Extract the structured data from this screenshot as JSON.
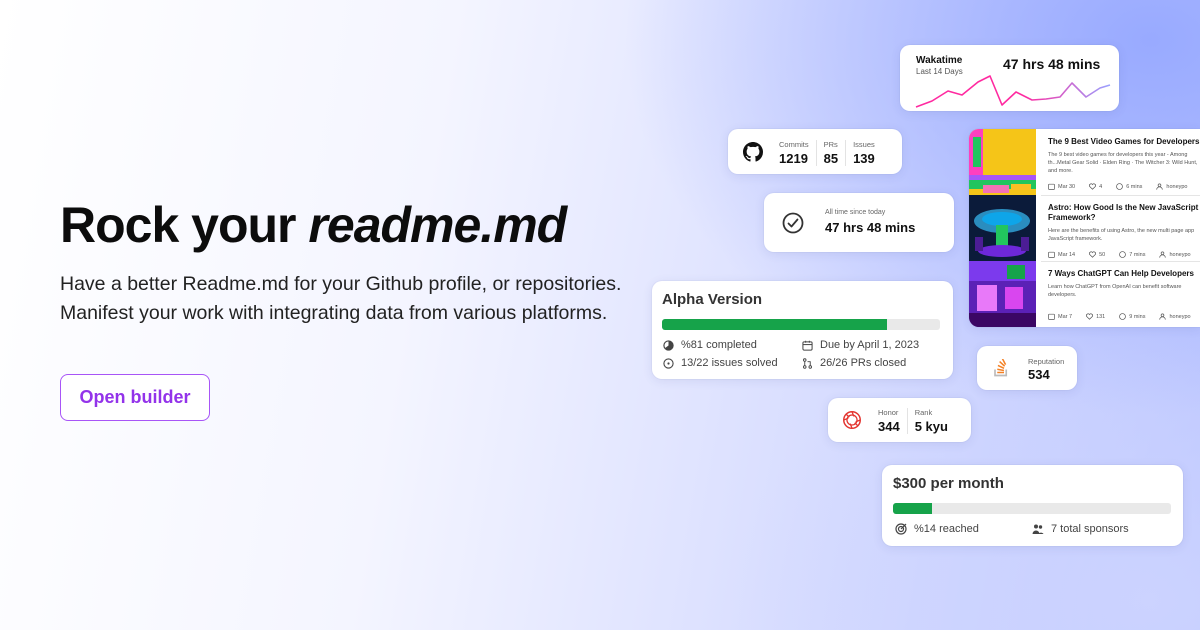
{
  "hero": {
    "title_main": "Rock your",
    "title_em": "readme.md",
    "desc_line1": "Have a better Readme.md for your Github profile, or repositories.",
    "desc_line2": "Manifest your work with integrating data from various platforms.",
    "button_label": "Open builder"
  },
  "wakatime": {
    "name": "Wakatime",
    "period": "Last 14 Days",
    "total": "47 hrs 48 mins"
  },
  "github": {
    "icon": "github-icon",
    "stats": [
      {
        "label": "Commits",
        "value": "1219"
      },
      {
        "label": "PRs",
        "value": "85"
      },
      {
        "label": "Issues",
        "value": "139"
      }
    ]
  },
  "alltime": {
    "icon": "check-clock-icon",
    "label": "All time since today",
    "value": "47 hrs 48 mins"
  },
  "milestone": {
    "title": "Alpha Version",
    "progress": 0.81,
    "completed": "%81 completed",
    "due": "Due by April 1, 2023",
    "issues": "13/22 issues solved",
    "prs": "26/26 PRs closed"
  },
  "articles": [
    {
      "title": "The 9 Best Video Games for Developers",
      "desc": "The 9 best video games for developers this year - Among th...Metal Gear Solid · Elden Ring · The Witcher 3: Wild Hunt, and more.",
      "date": "Mar 30",
      "likes": "4",
      "read": "6 mins",
      "author": "honeypo"
    },
    {
      "title": "Astro: How Good Is the New JavaScript Framework?",
      "desc": "Here are the benefits of using Astro, the new multi page app JavaScript framework.",
      "date": "Mar 14",
      "likes": "50",
      "read": "7 mins",
      "author": "honeypo"
    },
    {
      "title": "7 Ways ChatGPT Can Help Developers",
      "desc": "Learn how ChatGPT from OpenAI can benefit software developers.",
      "date": "Mar 7",
      "likes": "131",
      "read": "9 mins",
      "author": "honeypo"
    }
  ],
  "stackoverflow": {
    "icon": "stackoverflow-icon",
    "label": "Reputation",
    "value": "534"
  },
  "codewars": {
    "icon": "codewars-icon",
    "stats": [
      {
        "label": "Honor",
        "value": "344"
      },
      {
        "label": "Rank",
        "value": "5 kyu"
      }
    ]
  },
  "sponsors": {
    "title": "$300 per month",
    "progress": 0.14,
    "reached": "%14 reached",
    "count": "7 total sponsors"
  },
  "colors": {
    "accent": "#a855f7",
    "progress_green": "#16a34a",
    "wakatime_line": "#ff2aa0"
  }
}
